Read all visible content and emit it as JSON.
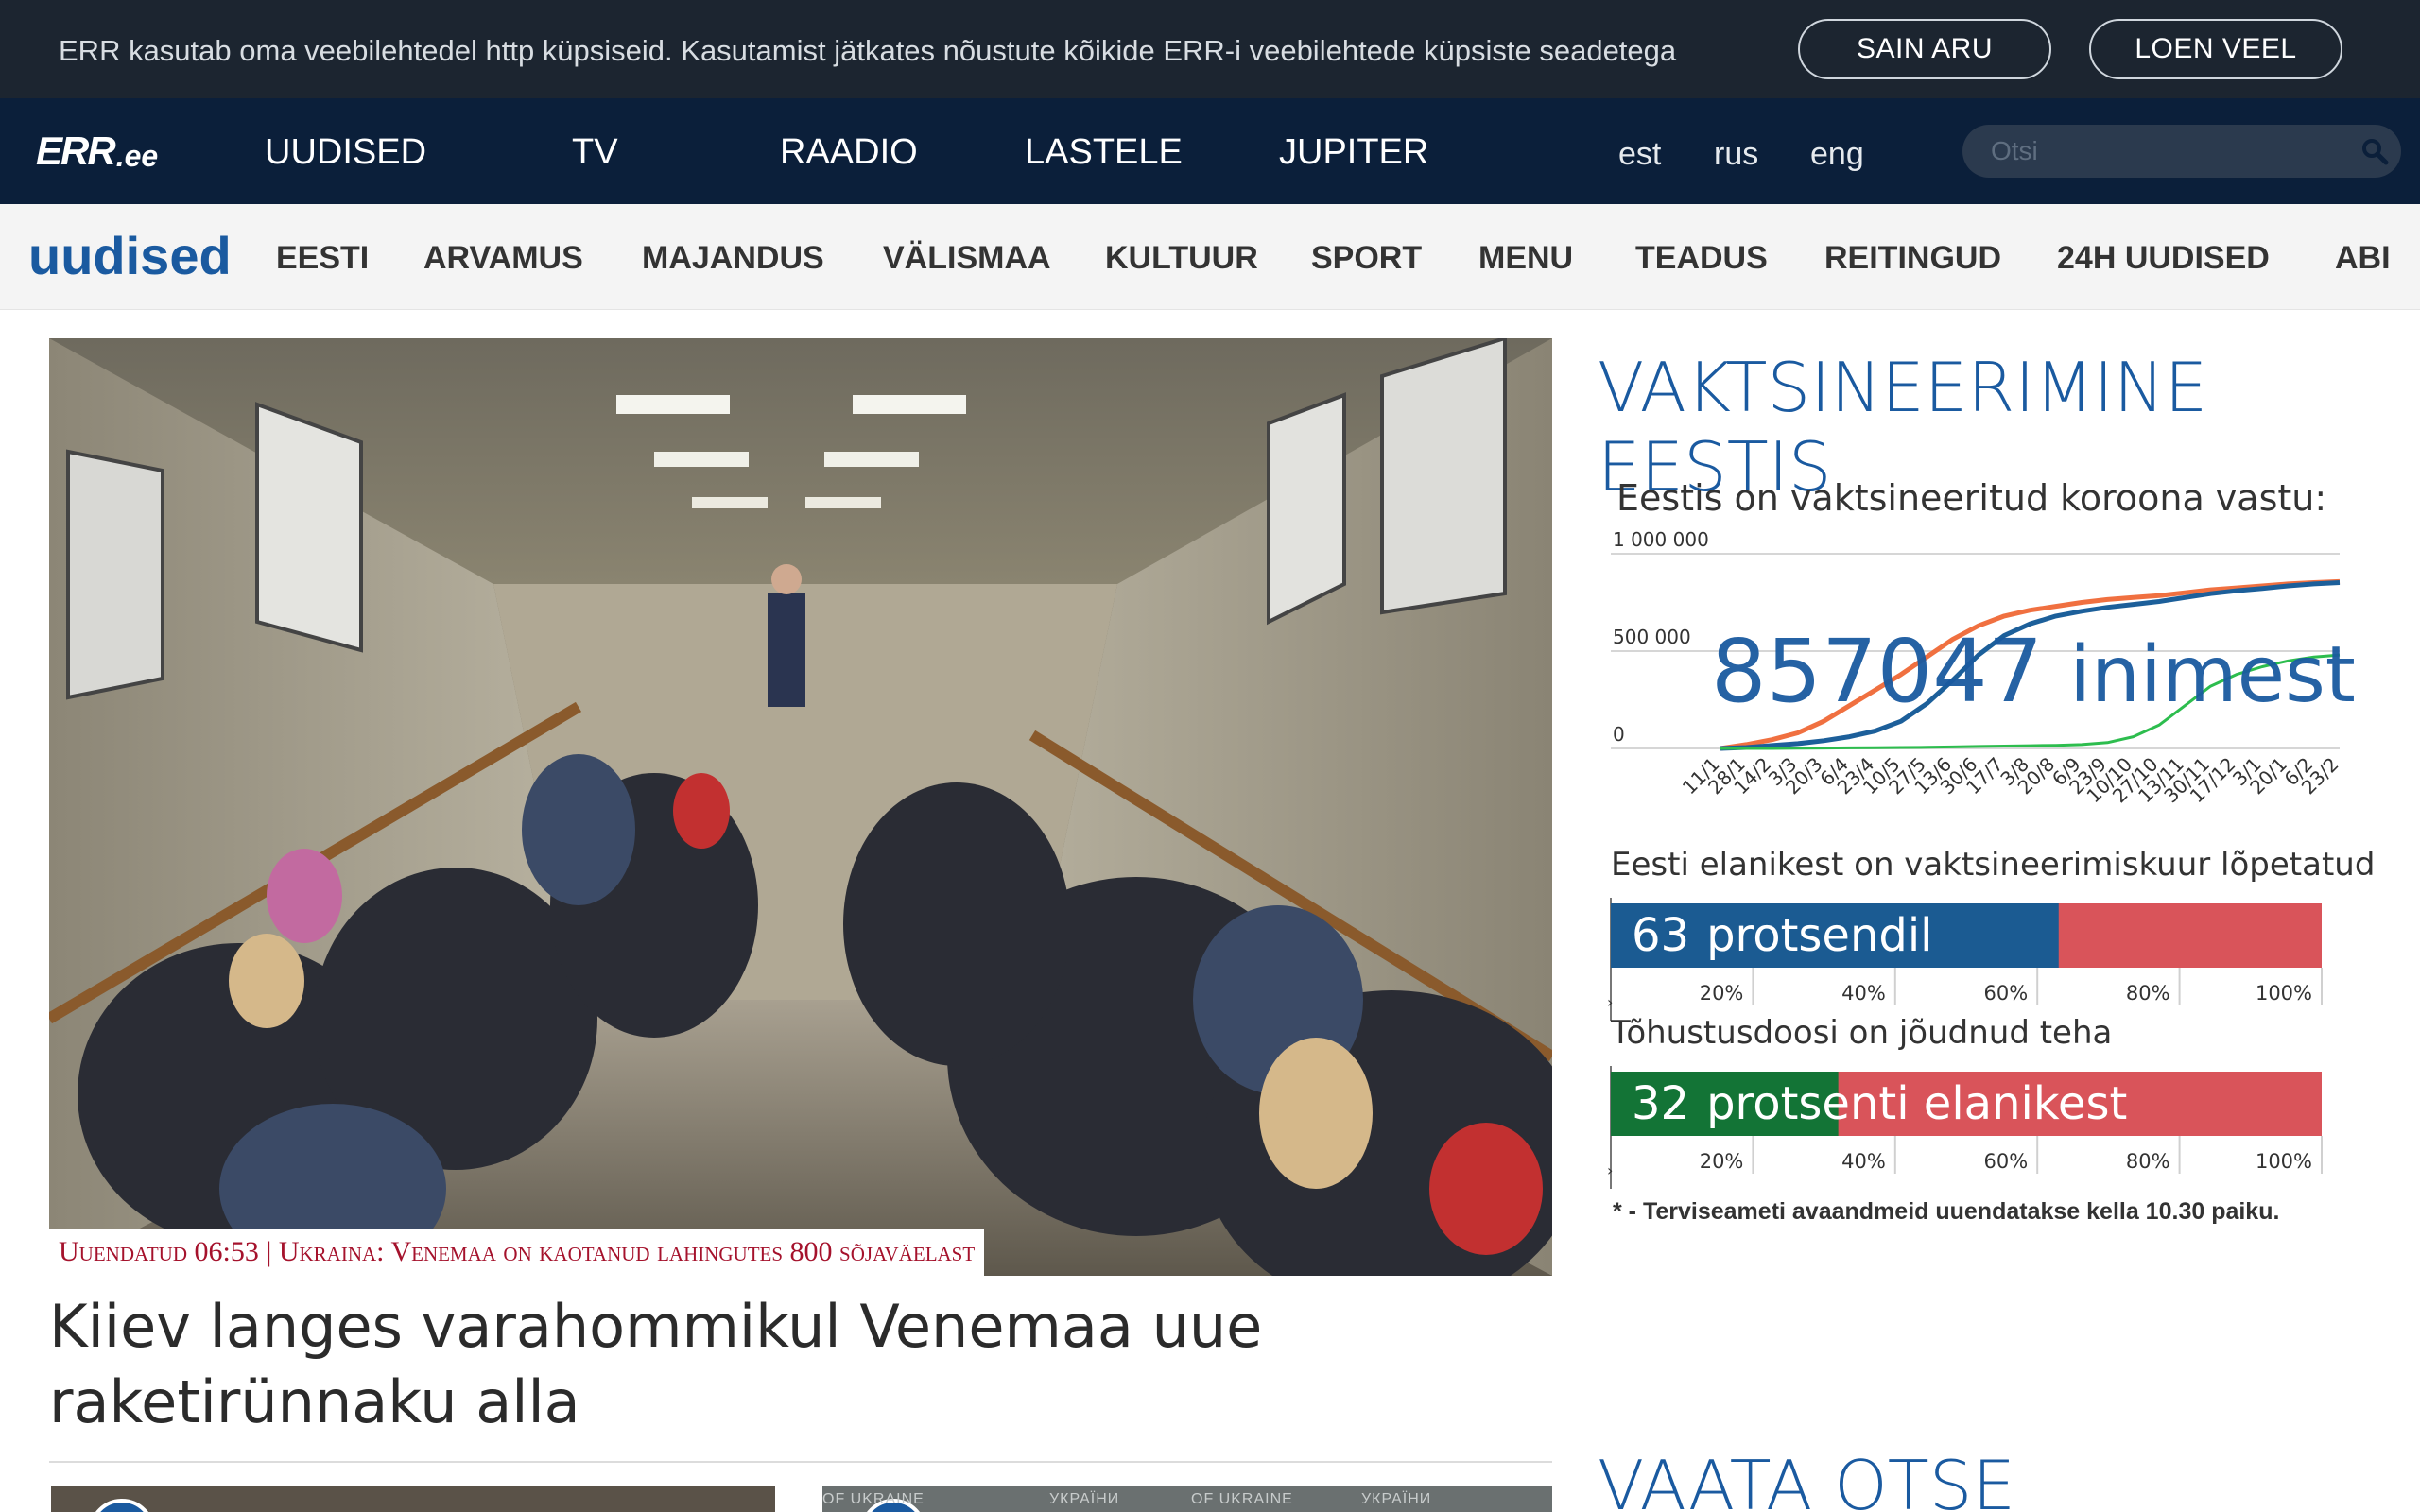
{
  "cookie": {
    "text": "ERR kasutab oma veebilehtedel http küpsiseid. Kasutamist jätkates nõustute kõikide ERR-i veebilehtede küpsiste seadetega",
    "accept_label": "SAIN ARU",
    "more_label": "LOEN VEEL"
  },
  "top_nav": {
    "logo_main": "ERR",
    "logo_suffix": ".ee",
    "links": [
      "UUDISED",
      "TV",
      "RAADIO",
      "LASTELE",
      "JUPITER"
    ],
    "languages": [
      "est",
      "rus",
      "eng"
    ],
    "search_placeholder": "Otsi"
  },
  "section_nav": {
    "section_logo": "uudised",
    "links": [
      "EESTI",
      "ARVAMUS",
      "MAJANDUS",
      "VÄLISMAA",
      "KULTUUR",
      "SPORT",
      "MENU",
      "TEADUS",
      "REITINGUD",
      "24H UUDISED",
      "ABI"
    ]
  },
  "main": {
    "caption": "Uuendatud 06:53 | Ukraina: Venemaa on kaotanud lahingutes 800 sõjaväelast",
    "headline": "Kiiev langes varahommikul Venemaa uue raketirünnaku alla",
    "thumb_b_text": [
      "OF UKRAINE",
      "УКРАЇНИ",
      "OF UKRAINE",
      "УКРАЇНИ"
    ]
  },
  "sidebar": {
    "title": "VAKTSINEERIMINE EESTIS",
    "live_title": "VAATA OTSE"
  },
  "colors": {
    "accent_blue": "#1a5aa0",
    "dark_navy": "#0b1f3a",
    "cookie_bg": "#1c2530",
    "caption_red": "#a5122c",
    "series_orange": "#f07040",
    "series_blue": "#1c5f9a",
    "series_green": "#2dbd4e",
    "bar_blue": "#1b5b92",
    "bar_green": "#137436",
    "bar_red": "#d9545a"
  },
  "chart_data": [
    {
      "type": "line",
      "title": "Eestis on vaktsineeritud koroona vastu:",
      "big_label_value": "857047",
      "big_label_unit": "inimest",
      "yticks": [
        "1 000 000",
        "500 000",
        "0"
      ],
      "ylim": [
        0,
        1000000
      ],
      "categories": [
        "11/1",
        "28/1",
        "14/2",
        "3/3",
        "20/3",
        "6/4",
        "23/4",
        "10/5",
        "27/5",
        "13/6",
        "30/6",
        "17/7",
        "3/8",
        "20/8",
        "6/9",
        "23/9",
        "10/10",
        "27/10",
        "13/11",
        "30/11",
        "17/12",
        "3/1",
        "20/1",
        "6/2",
        "23/2"
      ],
      "series": [
        {
          "values": [
            0,
            20000,
            45000,
            80000,
            140000,
            220000,
            300000,
            380000,
            470000,
            560000,
            630000,
            680000,
            710000,
            730000,
            750000,
            765000,
            775000,
            785000,
            800000,
            815000,
            825000,
            835000,
            845000,
            852000,
            857047
          ]
        },
        {
          "values": [
            0,
            5000,
            15000,
            25000,
            40000,
            60000,
            90000,
            140000,
            230000,
            350000,
            480000,
            580000,
            640000,
            680000,
            705000,
            725000,
            740000,
            755000,
            775000,
            795000,
            810000,
            822000,
            835000,
            845000,
            852000
          ]
        },
        {
          "values": [
            0,
            0,
            0,
            1000,
            2000,
            3000,
            4000,
            5000,
            6000,
            8000,
            10000,
            12000,
            14000,
            16000,
            20000,
            30000,
            60000,
            120000,
            220000,
            320000,
            380000,
            420000,
            450000,
            470000,
            480000
          ]
        }
      ]
    },
    {
      "type": "bar",
      "title": "Eesti elanikest on vaktsineerimiskuur lõpetatud",
      "value": 63,
      "value_label": "63",
      "unit_label": "protsendil",
      "xticks": [
        "20%",
        "40%",
        "60%",
        "80%",
        "100%"
      ],
      "xlim": [
        0,
        100
      ]
    },
    {
      "type": "bar",
      "title": "Tõhustusdoosi on jõudnud teha",
      "value": 32,
      "value_label": "32",
      "unit_label": "protsenti elanikest",
      "xticks": [
        "20%",
        "40%",
        "60%",
        "80%",
        "100%"
      ],
      "xlim": [
        0,
        100
      ]
    }
  ],
  "footnote": "* - Terviseameti avaandmeid uuendatakse kella 10.30 paiku."
}
